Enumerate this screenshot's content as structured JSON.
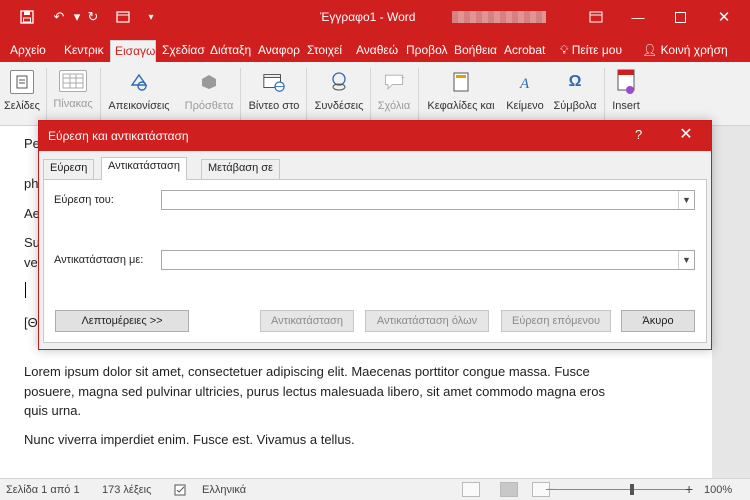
{
  "titlebar": {
    "doc_title": "Έγγραφο1 - Word",
    "icons": [
      "save-icon",
      "undo-icon",
      "redo-icon",
      "window-icon",
      "customize-icon"
    ],
    "window_controls": [
      "ribbon-display-icon",
      "minimize-icon",
      "maximize-icon",
      "close-icon"
    ],
    "brand_color": "#cf1f1f"
  },
  "tabs": [
    {
      "label": "Αρχείο"
    },
    {
      "label": "Κεντρικ"
    },
    {
      "label": "Εισαγω"
    },
    {
      "label": "Σχεδίασ"
    },
    {
      "label": "Διάταξη"
    },
    {
      "label": "Αναφορ"
    },
    {
      "label": "Στοιχεί"
    },
    {
      "label": "Αναθεώ"
    },
    {
      "label": "Προβολ"
    },
    {
      "label": "Βοήθεια"
    },
    {
      "label": "Acrobat"
    }
  ],
  "tell_me": "Πείτε μου",
  "share": "Κοινή χρήση",
  "ribbon": [
    {
      "label": "Σελίδες",
      "icon": "pages-icon"
    },
    {
      "label": "Πίνακας",
      "icon": "table-icon"
    },
    {
      "label": "Απεικονίσεις",
      "icon": "illustrations-icon"
    },
    {
      "label": "Πρόσθετα",
      "icon": "addins-icon"
    },
    {
      "label": "Βίντεο στο",
      "icon": "video-icon"
    },
    {
      "label": "Συνδέσεις",
      "icon": "links-icon"
    },
    {
      "label": "Σχόλια",
      "icon": "comment-icon"
    },
    {
      "label": "Κεφαλίδες και",
      "icon": "header-footer-icon"
    },
    {
      "label": "Κείμενο",
      "icon": "text-icon"
    },
    {
      "label": "Σύμβολα",
      "icon": "omega-icon"
    },
    {
      "label": "Insert",
      "icon": "insert-icon"
    }
  ],
  "document": {
    "frag_pe": "Pe",
    "frag_ph": "ph",
    "frag_ae": "Ae",
    "frag_su": "Su",
    "frag_ve": "ve",
    "frag_bracket": "[Θ",
    "para1_line1": "Lorem ipsum dolor sit amet, consectetuer adipiscing elit. Maecenas porttitor congue massa. Fusce",
    "para1_line2": "posuere, magna sed pulvinar ultricies, purus lectus malesuada libero, sit amet commodo magna eros",
    "para1_line3": "quis urna.",
    "para2": "Nunc viverra imperdiet enim. Fusce est. Vivamus a tellus."
  },
  "status": {
    "page": "Σελίδα 1 από 1",
    "words": "173 λέξεις",
    "language": "Ελληνικά",
    "zoom_minus": "−",
    "zoom_plus": "+",
    "zoom": "100%",
    "zoom_level": 1.0
  },
  "dialog": {
    "title": "Εύρεση και αντικατάσταση",
    "help": "?",
    "close": "✕",
    "tabs": [
      {
        "label": "Εύρεση"
      },
      {
        "label": "Αντικατάσταση"
      },
      {
        "label": "Μετάβαση σε"
      }
    ],
    "find_label": "Εύρεση του:",
    "find_value": "",
    "replace_label": "Αντικατάσταση με:",
    "replace_value": "",
    "buttons": {
      "more": "Λεπτομέρειες >>",
      "replace": "Αντικατάσταση",
      "replace_all": "Αντικατάσταση όλων",
      "find_next": "Εύρεση επόμενου",
      "cancel": "Άκυρο"
    }
  }
}
